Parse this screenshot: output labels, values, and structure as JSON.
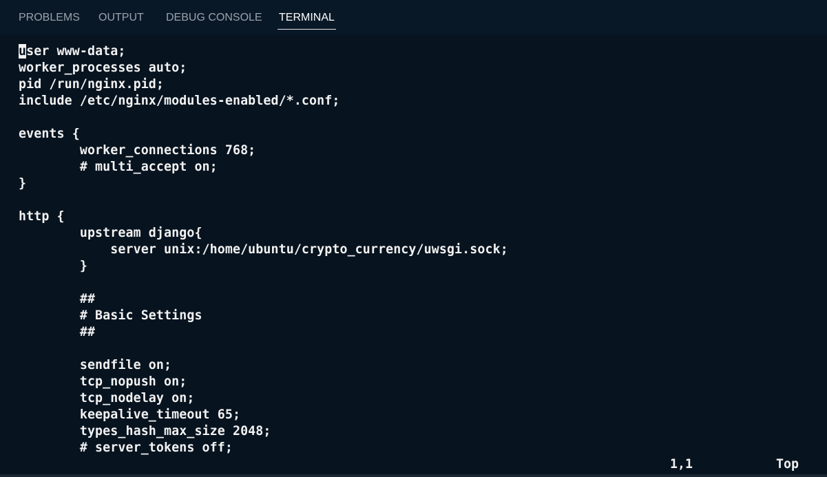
{
  "tabs": [
    {
      "label": "PROBLEMS"
    },
    {
      "label": "OUTPUT"
    },
    {
      "label": "DEBUG CONSOLE"
    },
    {
      "label": "TERMINAL",
      "active": true
    }
  ],
  "terminal": {
    "cursor_char": "u",
    "first_line_rest": "ser www-data;",
    "lines": [
      "",
      "worker_processes auto;",
      "pid /run/nginx.pid;",
      "include /etc/nginx/modules-enabled/*.conf;",
      "",
      "events {",
      "        worker_connections 768;",
      "        # multi_accept on;",
      "}",
      "",
      "http {",
      "        upstream django{",
      "            server unix:/home/ubuntu/crypto_currency/uwsgi.sock;",
      "        }",
      "",
      "        ##",
      "        # Basic Settings",
      "        ##",
      "",
      "        sendfile on;",
      "        tcp_nopush on;",
      "        tcp_nodelay on;",
      "        keepalive_timeout 65;",
      "        types_hash_max_size 2048;",
      "        # server_tokens off;"
    ],
    "status_position": "1,1",
    "status_scroll": "Top"
  },
  "colors": {
    "background": "#07131f",
    "tabbar": "#091827",
    "text": "#f2f2f2",
    "tab_inactive": "#9aa2ab"
  }
}
